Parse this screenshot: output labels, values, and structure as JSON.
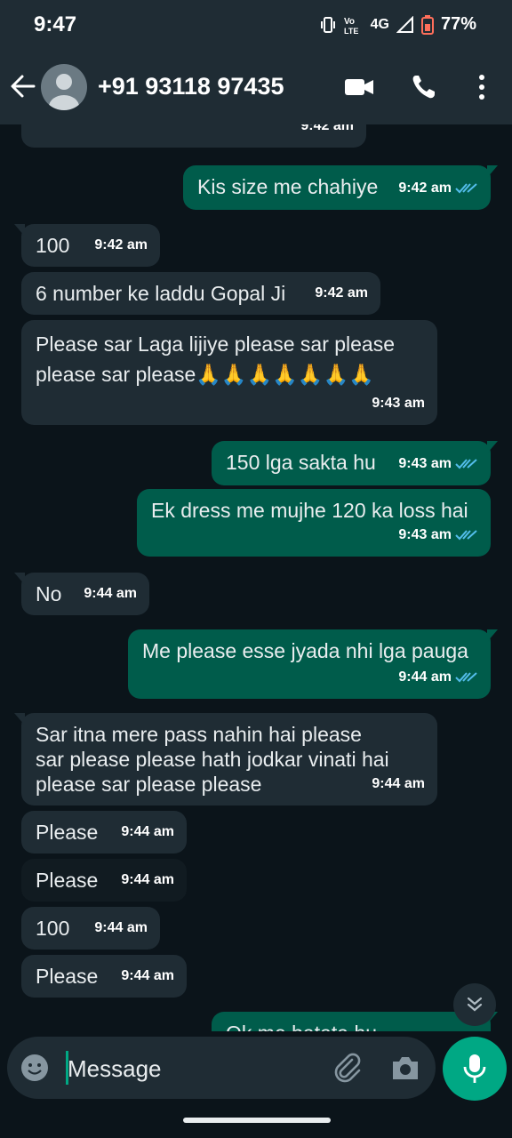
{
  "status_bar": {
    "time": "9:47",
    "network": "4G",
    "battery": "77%"
  },
  "header": {
    "contact": "+91 93118 97435"
  },
  "messages": [
    {
      "dir": "in",
      "text": "",
      "time": "9:42 am"
    },
    {
      "dir": "out",
      "text": "Kis size me chahiye",
      "time": "9:42 am"
    },
    {
      "dir": "in",
      "text": "100",
      "time": "9:42 am"
    },
    {
      "dir": "in",
      "text": "6 number ke laddu Gopal Ji",
      "time": "9:42 am"
    },
    {
      "dir": "in",
      "text": "Please sar Laga lijiye please sar please\nplease sar please🙏🙏🙏🙏🙏🙏🙏",
      "time": "9:43 am"
    },
    {
      "dir": "out",
      "text": "150 lga sakta hu",
      "time": "9:43 am"
    },
    {
      "dir": "out",
      "text": "Ek dress me mujhe 120 ka loss hai",
      "time": "9:43 am"
    },
    {
      "dir": "in",
      "text": "No",
      "time": "9:44 am"
    },
    {
      "dir": "out",
      "text": "Me please esse jyada nhi lga pauga",
      "time": "9:44 am"
    },
    {
      "dir": "in",
      "text": "Sar itna mere pass nahin hai please\nsar please please hath jodkar vinati hai\nplease sar please please",
      "time": "9:44 am"
    },
    {
      "dir": "in",
      "text": "Please",
      "time": "9:44 am"
    },
    {
      "dir": "in",
      "text": "Please",
      "time": "9:44 am"
    },
    {
      "dir": "in",
      "text": "100",
      "time": "9:44 am"
    },
    {
      "dir": "in",
      "text": "Please",
      "time": "9:44 am"
    },
    {
      "dir": "out",
      "text": "Ok me batata hu",
      "time": ""
    }
  ],
  "composer": {
    "placeholder": "Message"
  },
  "colors": {
    "incoming": "#1f2c34",
    "outgoing": "#005c4b",
    "accent": "#00a884",
    "tick": "#53bdeb"
  }
}
